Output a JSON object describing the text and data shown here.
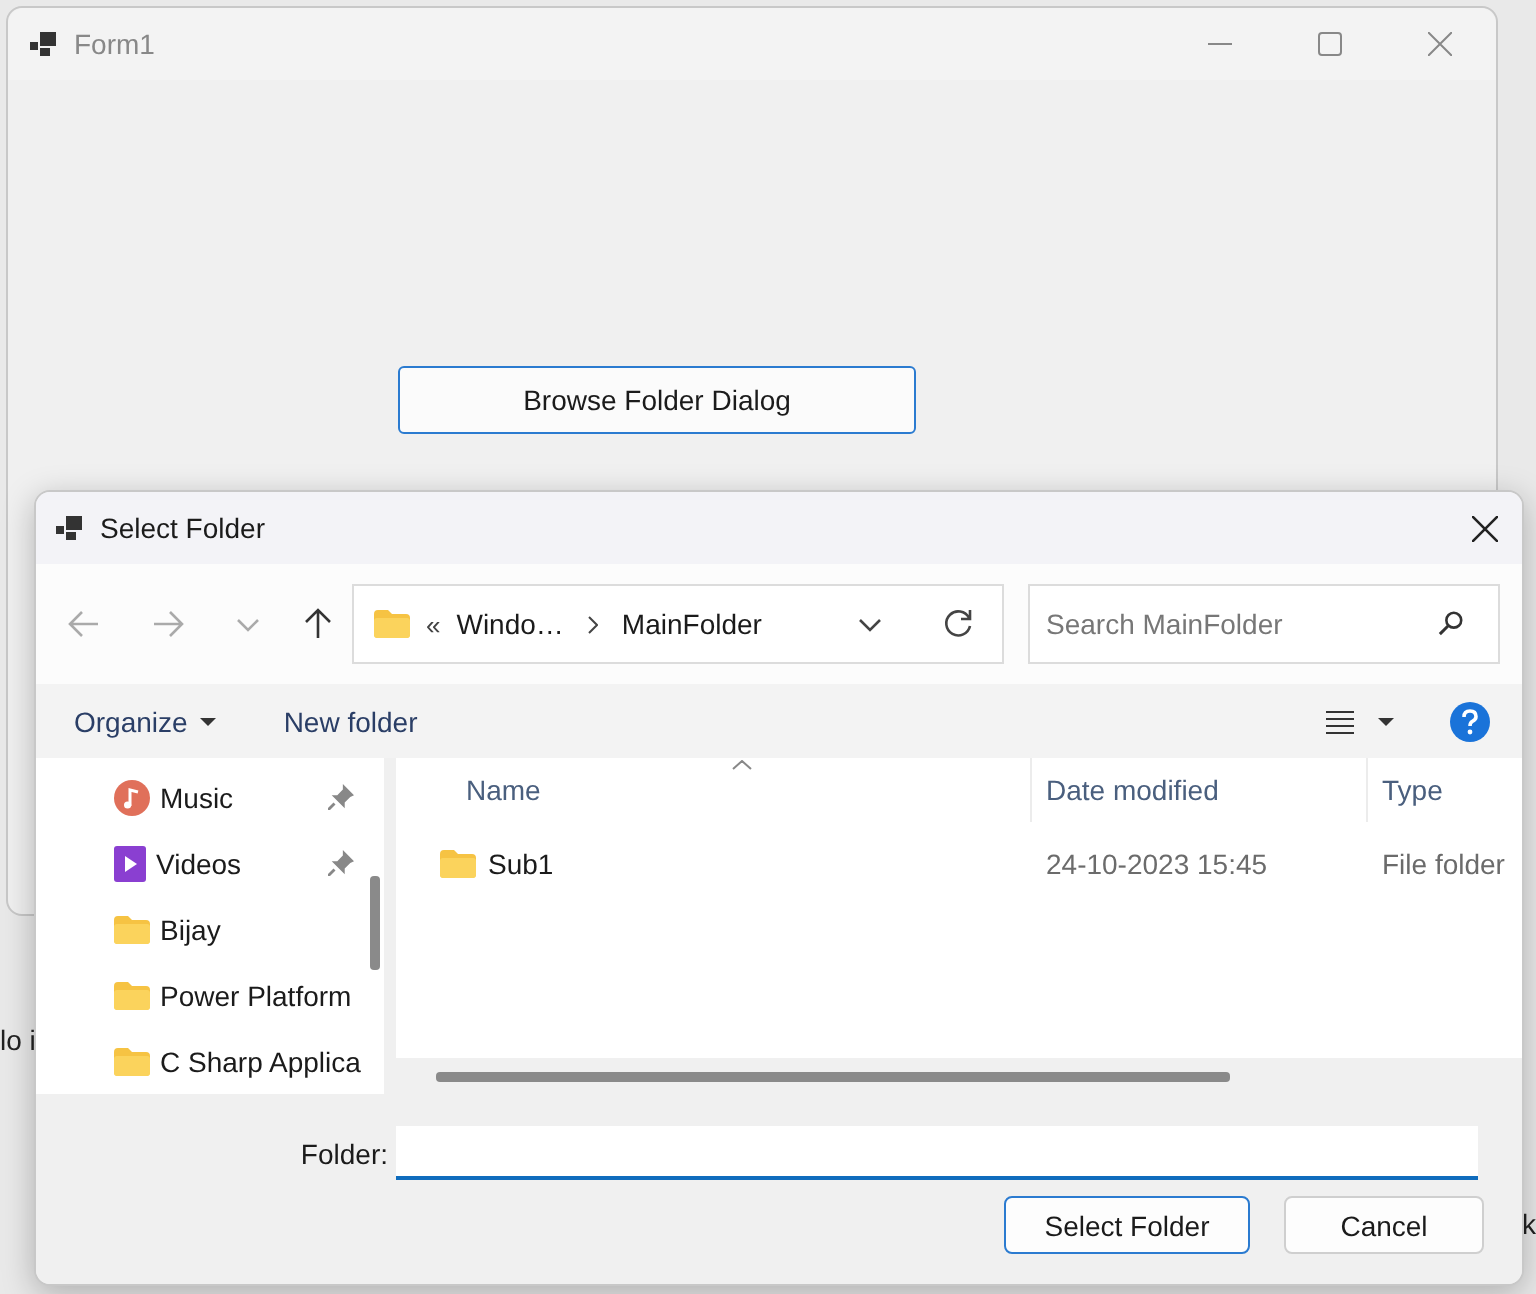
{
  "background": {
    "fragments": [
      "lo i",
      "k"
    ]
  },
  "form": {
    "title": "Form1",
    "button": "Browse Folder Dialog"
  },
  "dialog": {
    "title": "Select Folder",
    "nav": {
      "back_enabled": false,
      "forward_enabled": false,
      "up_enabled": true
    },
    "address": {
      "overflow": "«",
      "crumbs": [
        "Windo…",
        "MainFolder"
      ]
    },
    "search": {
      "placeholder": "Search MainFolder"
    },
    "commands": {
      "organize": "Organize",
      "new_folder": "New folder"
    },
    "sidebar": {
      "items": [
        {
          "label": "Music",
          "kind": "music",
          "pinned": true
        },
        {
          "label": "Videos",
          "kind": "video",
          "pinned": true
        },
        {
          "label": "Bijay",
          "kind": "folder",
          "pinned": false
        },
        {
          "label": "Power Platform",
          "kind": "folder",
          "pinned": false
        },
        {
          "label": "C Sharp Applica",
          "kind": "folder",
          "pinned": false
        }
      ]
    },
    "columns": [
      {
        "label": "Name",
        "sorted": true
      },
      {
        "label": "Date modified",
        "sorted": false
      },
      {
        "label": "Type",
        "sorted": false
      }
    ],
    "rows": [
      {
        "name": "Sub1",
        "date": "24-10-2023 15:45",
        "type": "File folder",
        "selected": false
      }
    ],
    "folder": {
      "label": "Folder:"
    },
    "buttons": [
      {
        "label": "Select Folder",
        "default": true
      },
      {
        "label": "Cancel",
        "default": false
      }
    ]
  }
}
